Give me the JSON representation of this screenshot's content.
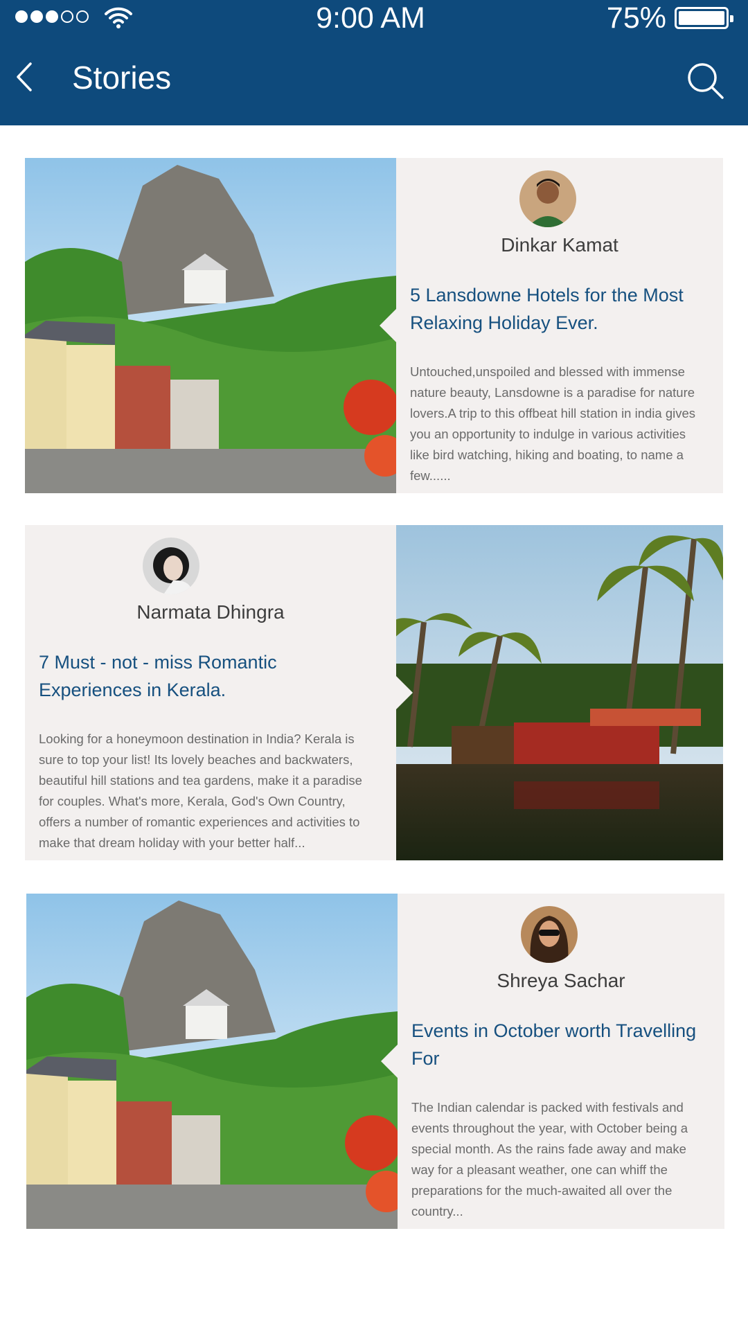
{
  "status_bar": {
    "time": "9:00 AM",
    "battery_pct": "75%",
    "signal_bars": 3,
    "signal_total": 5
  },
  "nav": {
    "title": "Stories",
    "back_icon": "chevron-left-icon",
    "search_icon": "search-icon"
  },
  "stories": [
    {
      "author": "Dinkar Kamat",
      "title": "5 Lansdowne Hotels for the Most Relaxing Holiday Ever.",
      "excerpt": "Untouched,unspoiled and blessed with immense nature beauty, Lansdowne is a paradise for nature lovers.A trip to this offbeat hill station in india gives you an opportunity to indulge in various activities like bird watching, hiking and boating, to name a few......",
      "image": "hill-town-photo"
    },
    {
      "author": "Narmata Dhingra",
      "title": "7 Must - not - miss Romantic Experiences in Kerala.",
      "excerpt": "Looking for a honeymoon destination in India?  Kerala is sure to top your list!  Its lovely beaches and backwaters, beautiful hill stations and tea gardens, make it a paradise for couples. What's more, Kerala, God's Own Country, offers a number of romantic experiences and activities to make that dream holiday with your better half...",
      "image": "kerala-houseboat-photo"
    },
    {
      "author": "Shreya Sachar",
      "title": "Events in October worth Travelling For",
      "excerpt": "The Indian calendar is packed with festivals and events throughout the year, with October being a special month. As the rains fade away and make way for a pleasant weather, one can whiff the preparations for the much-awaited all over the country...",
      "image": "hill-town-photo"
    }
  ],
  "colors": {
    "header": "#0e4a7c",
    "title": "#16507f",
    "card_bg": "#f3f0ef"
  }
}
